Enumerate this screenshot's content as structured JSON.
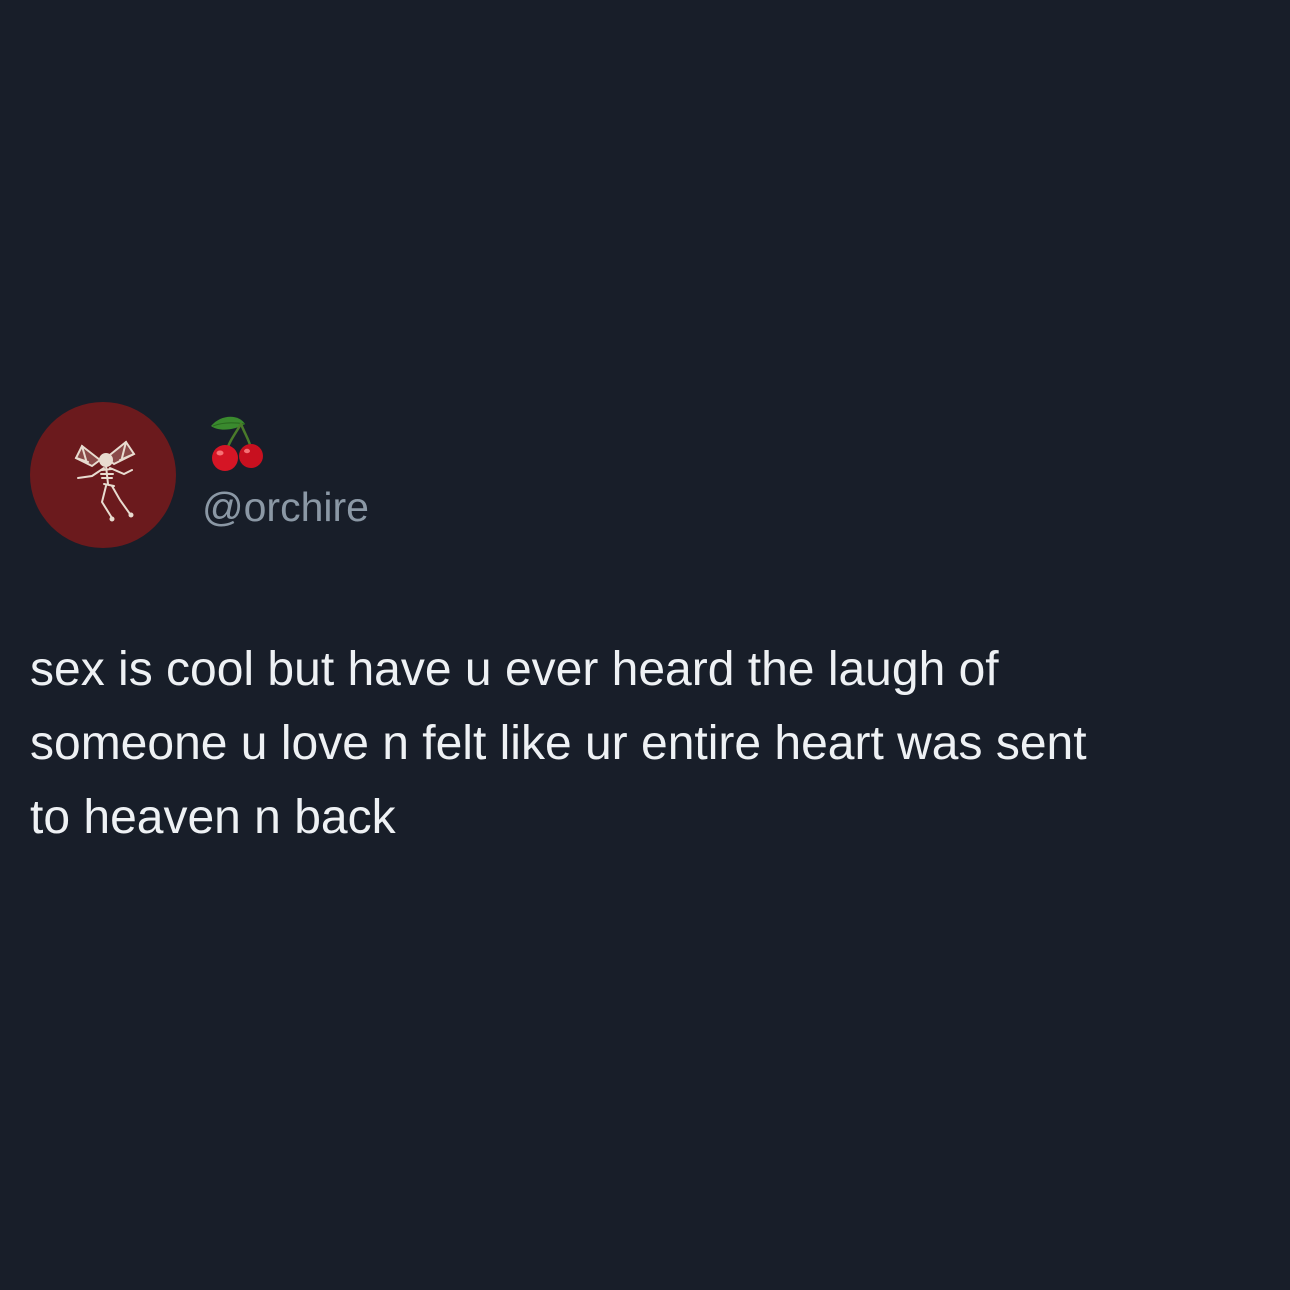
{
  "tweet": {
    "author": {
      "display_name_icon": "cherries-emoji",
      "handle": "@orchire",
      "avatar_icon": "skeleton-fairy-icon",
      "avatar_color": "#6b1a1d"
    },
    "text_lines": [
      "sex is cool but have u ever heard the laugh of",
      "someone u love n felt like ur entire heart was sent",
      "to heaven n back"
    ]
  },
  "colors": {
    "background": "#181e29",
    "text": "#eef1f4",
    "handle": "#8b98a5"
  }
}
